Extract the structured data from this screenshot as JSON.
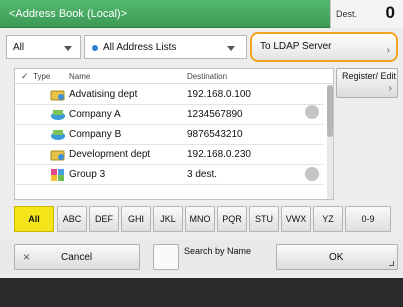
{
  "header": {
    "title": "<Address Book (Local)>",
    "dest_label": "Dest.",
    "dest_count": "0"
  },
  "filters": {
    "type_value": "All",
    "list_value": "All Address Lists",
    "ldap_button": "To LDAP Server"
  },
  "list": {
    "columns": {
      "type": "Type",
      "name": "Name",
      "destination": "Destination"
    },
    "rows": [
      {
        "name": "Advatising dept",
        "dest": "192.168.0.100",
        "icon": "folder-network-icon"
      },
      {
        "name": "Company A",
        "dest": "1234567890",
        "icon": "fax-icon"
      },
      {
        "name": "Company B",
        "dest": "9876543210",
        "icon": "fax-icon"
      },
      {
        "name": "Development dept",
        "dest": "192.168.0.230",
        "icon": "folder-network-icon"
      },
      {
        "name": "Group 3",
        "dest": "3 dest.",
        "icon": "group-icon"
      }
    ]
  },
  "register_button": "Register/ Edit",
  "alphabet": [
    "All",
    "ABC",
    "DEF",
    "GHI",
    "JKL",
    "MNO",
    "PQR",
    "STU",
    "VWX",
    "YZ",
    "0-9"
  ],
  "actions": {
    "cancel": "Cancel",
    "search_by_name": "Search by Name",
    "ok": "OK"
  },
  "colors": {
    "header": "#47a862",
    "highlight": "#f3a21b",
    "active_tab": "#f3e51a"
  }
}
